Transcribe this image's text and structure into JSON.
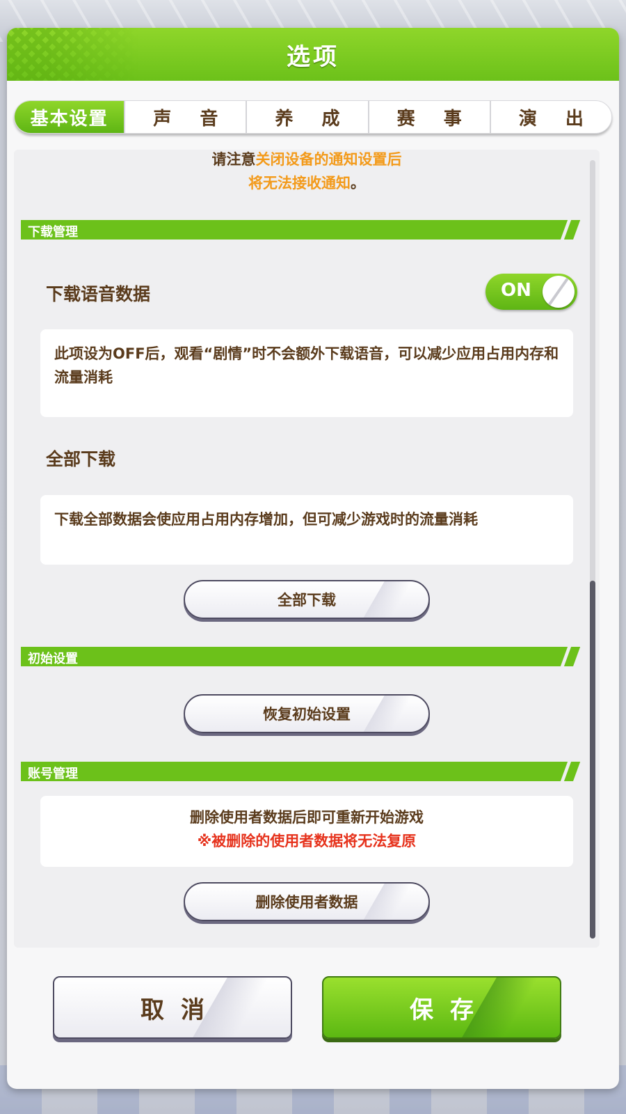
{
  "dialog": {
    "title": "选项"
  },
  "tabs": [
    {
      "label": "基本设置",
      "active": true
    },
    {
      "label": "声 音",
      "active": false
    },
    {
      "label": "养 成",
      "active": false
    },
    {
      "label": "赛 事",
      "active": false
    },
    {
      "label": "演 出",
      "active": false
    }
  ],
  "notice": {
    "prefix": "请注意",
    "highlight1": "关闭设备的通知设置后",
    "highlight2": "将无法接收通知",
    "suffix": "。"
  },
  "sections": {
    "download": {
      "title": "下载管理",
      "voice_label": "下载语音数据",
      "voice_toggle": "ON",
      "voice_desc": "此项设为OFF后，观看“剧情”时不会额外下载语音，可以减少应用占用内存和流量消耗",
      "all_label": "全部下载",
      "all_desc": "下载全部数据会使应用占用内存增加，但可减少游戏时的流量消耗",
      "all_button": "全部下载"
    },
    "init": {
      "title": "初始设置",
      "button": "恢复初始设置"
    },
    "account": {
      "title": "账号管理",
      "desc": "删除使用者数据后即可重新开始游戏",
      "warning": "※被删除的使用者数据将无法复原",
      "button": "删除使用者数据"
    }
  },
  "footer": {
    "cancel": "取消",
    "save": "保存"
  },
  "colors": {
    "accent_green": "#6cc11a",
    "text_brown": "#5a3b1c",
    "notice_orange": "#f39a1a",
    "warning_red": "#e6321c"
  }
}
